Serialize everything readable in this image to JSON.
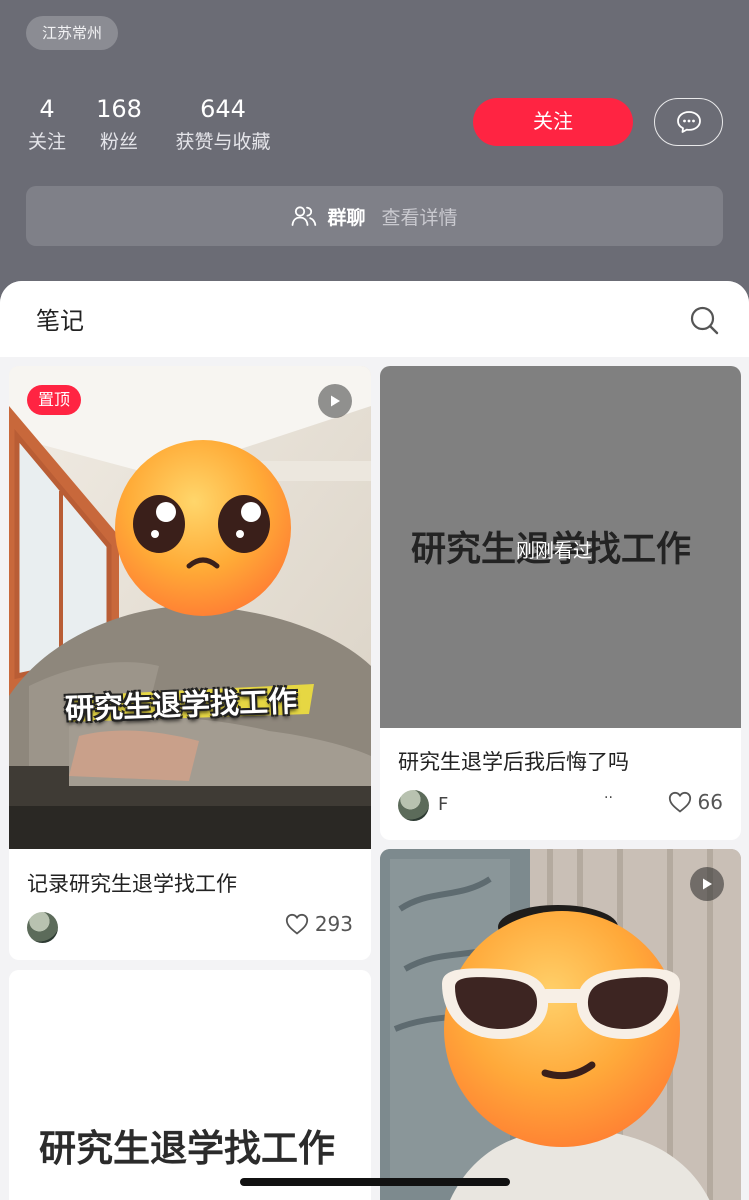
{
  "profile": {
    "location": "江苏常州",
    "stats": [
      {
        "value": "4",
        "label": "关注"
      },
      {
        "value": "168",
        "label": "粉丝"
      },
      {
        "value": "644",
        "label": "获赞与收藏"
      }
    ],
    "follow_label": "关注",
    "group": {
      "label": "群聊",
      "detail": "查看详情"
    }
  },
  "tabs": {
    "notes_label": "笔记"
  },
  "notes": [
    {
      "pin_label": "置顶",
      "overlay_caption": "研究生退学找工作",
      "title": "记录研究生退学找工作",
      "likes": "293"
    },
    {
      "cover_title": "研究生退学找工作",
      "viewed_label": "刚刚看过",
      "title": "研究生退学后我后悔了吗",
      "author": "F",
      "author_tail": "..",
      "likes": "66"
    },
    {
      "cover_title": "研究生退学找工作"
    },
    {}
  ],
  "colors": {
    "accent": "#ff2442",
    "header_bg": "#6b6c75",
    "panel_bg": "#f3f3f5"
  }
}
